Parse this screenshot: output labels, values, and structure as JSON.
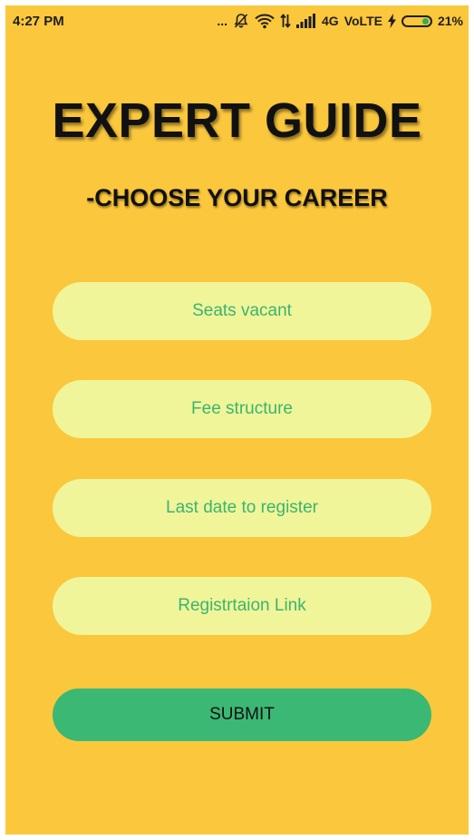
{
  "status_bar": {
    "time": "4:27 PM",
    "dots": "...",
    "network": "4G",
    "volte": "VoLTE",
    "battery_percent": "21%",
    "battery_level": 0.21
  },
  "header": {
    "title": "EXPERT GUIDE",
    "subtitle": "-CHOOSE YOUR CAREER"
  },
  "form": {
    "fields": [
      {
        "placeholder": "Seats vacant",
        "value": ""
      },
      {
        "placeholder": "Fee structure",
        "value": ""
      },
      {
        "placeholder": "Last date to register",
        "value": ""
      },
      {
        "placeholder": "Registrtaion Link",
        "value": ""
      }
    ],
    "submit_label": "SUBMIT"
  },
  "colors": {
    "background": "#FBC73C",
    "field_bg": "#F0F59A",
    "field_text": "#3BB46E",
    "submit_bg": "#3BB874",
    "battery_indicator": "#2FB34A"
  }
}
